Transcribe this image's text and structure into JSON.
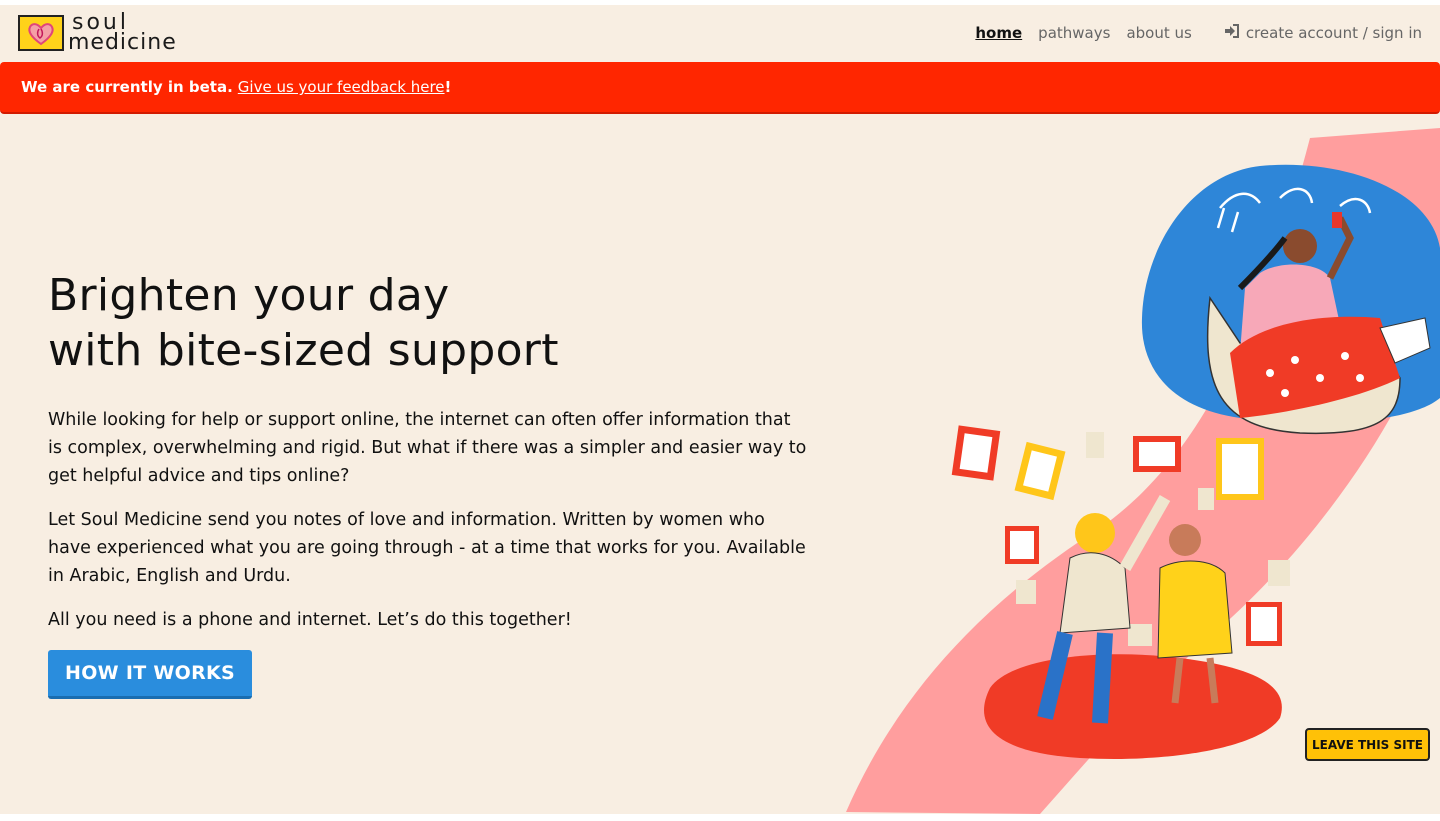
{
  "brand": {
    "line1": "soul",
    "line2": "medicine"
  },
  "nav": {
    "items": [
      {
        "label": "home"
      },
      {
        "label": "pathways"
      },
      {
        "label": "about us"
      }
    ],
    "signin_label": "create account / sign in"
  },
  "beta": {
    "text": "We are currently in beta.",
    "link": "Give us your feedback here",
    "suffix": "!"
  },
  "hero": {
    "title_line1": "Brighten your day",
    "title_line2": "with bite-sized support",
    "p1": "While looking for help or support online, the internet can often offer information that is complex, overwhelming and rigid. But what if there was a simpler and easier way to get helpful advice and tips online?",
    "p2": "Let Soul Medicine send you notes of love and information. Written by women who have experienced what you are going through - at a time that works for you. Available in Arabic, English and Urdu.",
    "p3": "All you need is a phone and internet. Let’s do this together!",
    "cta": "HOW IT WORKS"
  },
  "leave_site": "LEAVE THIS SITE",
  "colors": {
    "background": "#f8eee2",
    "beta_banner": "#ff2600",
    "cta": "#2a8ddd",
    "leave_button": "#ffc107",
    "logo_yellow": "#ffd21a"
  },
  "icons": {
    "logo": "heart-icon",
    "signin": "sign-in-icon"
  }
}
